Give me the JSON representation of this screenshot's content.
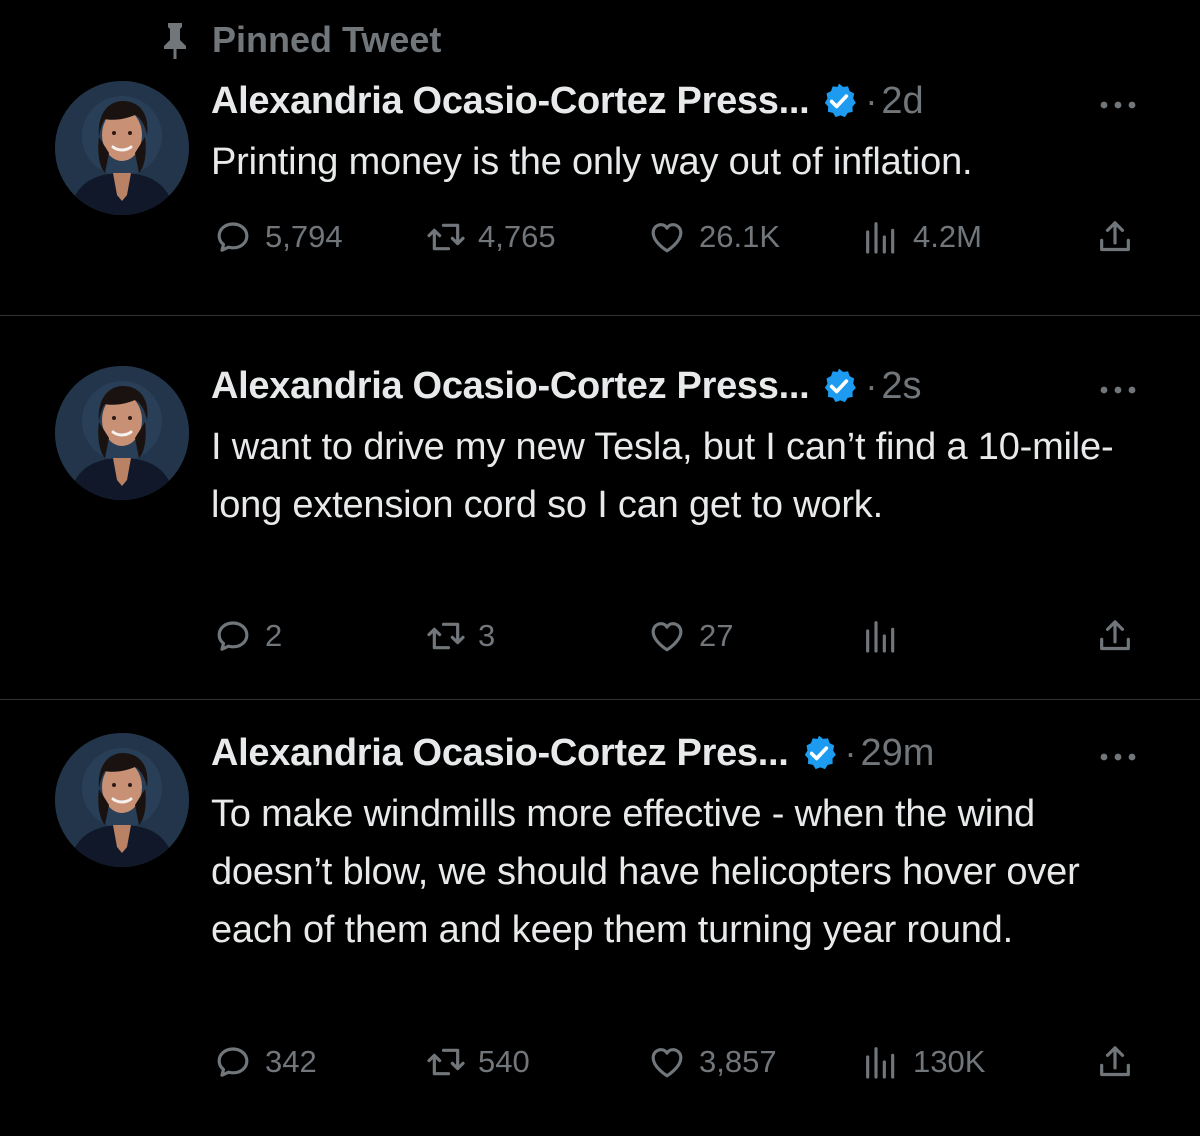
{
  "pinned_label": "Pinned Tweet",
  "colors": {
    "background": "#000000",
    "text": "#e7e9ea",
    "muted": "#71767b",
    "verified": "#1d9bf0",
    "divider": "#2f3336"
  },
  "tweets": [
    {
      "author": "Alexandria Ocasio-Cortez Press...",
      "separator": "·",
      "time": "2d",
      "text": "Printing money is the only way out of inflation.",
      "replies": "5,794",
      "retweets": "4,765",
      "likes": "26.1K",
      "views": "4.2M"
    },
    {
      "author": "Alexandria Ocasio-Cortez Press...",
      "separator": "·",
      "time": "2s",
      "text": "I want to drive my new Tesla, but I can’t find a 10-mile-long extension cord so I can get to work.",
      "replies": "2",
      "retweets": "3",
      "likes": "27",
      "views": ""
    },
    {
      "author": "Alexandria Ocasio-Cortez Pres...",
      "separator": "·",
      "time": "29m",
      "text": "To make windmills more effective - when the wind doesn’t blow, we should have helicopters hover over each of them and keep them turning year round.",
      "replies": "342",
      "retweets": "540",
      "likes": "3,857",
      "views": "130K"
    }
  ],
  "icons": {
    "pin": "pin-icon",
    "verified": "verified-badge-icon",
    "more": "more-options-icon",
    "reply": "reply-icon",
    "retweet": "retweet-icon",
    "like": "heart-icon",
    "views": "views-chart-icon",
    "share": "share-icon"
  }
}
